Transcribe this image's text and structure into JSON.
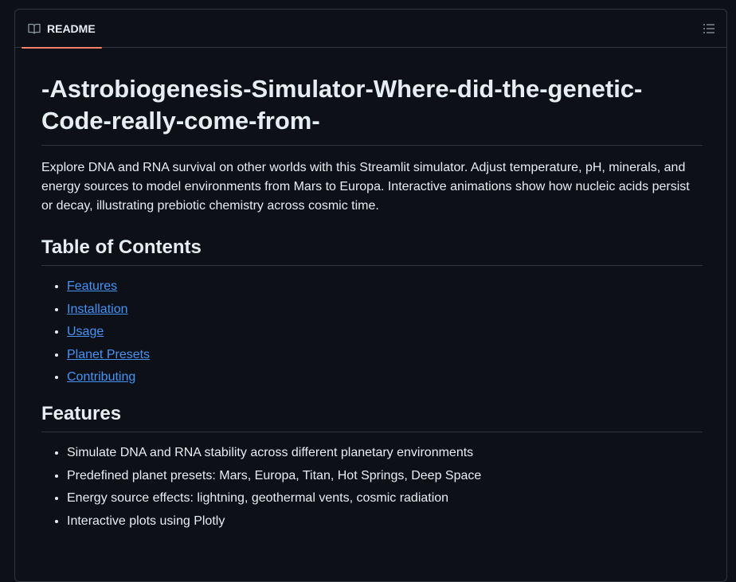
{
  "readme": {
    "tab_label": "README",
    "book_icon": "book-icon",
    "outline_icon": "list-unordered-icon"
  },
  "article": {
    "title": "-Astrobiogenesis-Simulator-Where-did-the-genetic-Code-really-come-from-",
    "intro": "Explore DNA and RNA survival on other worlds with this Streamlit simulator. Adjust temperature, pH, minerals, and energy sources to model environments from Mars to Europa. Interactive animations show how nucleic acids persist or decay, illustrating prebiotic chemistry across cosmic time.",
    "toc_heading": "Table of Contents",
    "toc": [
      {
        "label": "Features"
      },
      {
        "label": "Installation"
      },
      {
        "label": "Usage"
      },
      {
        "label": "Planet Presets"
      },
      {
        "label": "Contributing"
      }
    ],
    "features_heading": "Features",
    "features": [
      "Simulate DNA and RNA stability across different planetary environments",
      "Predefined planet presets: Mars, Europa, Titan, Hot Springs, Deep Space",
      "Energy source effects: lightning, geothermal vents, cosmic radiation",
      "Interactive plots using Plotly"
    ]
  },
  "colors": {
    "background": "#0d1117",
    "border": "#30363d",
    "text": "#e6edf3",
    "link": "#4493f8",
    "tab_underline": "#f78166"
  }
}
